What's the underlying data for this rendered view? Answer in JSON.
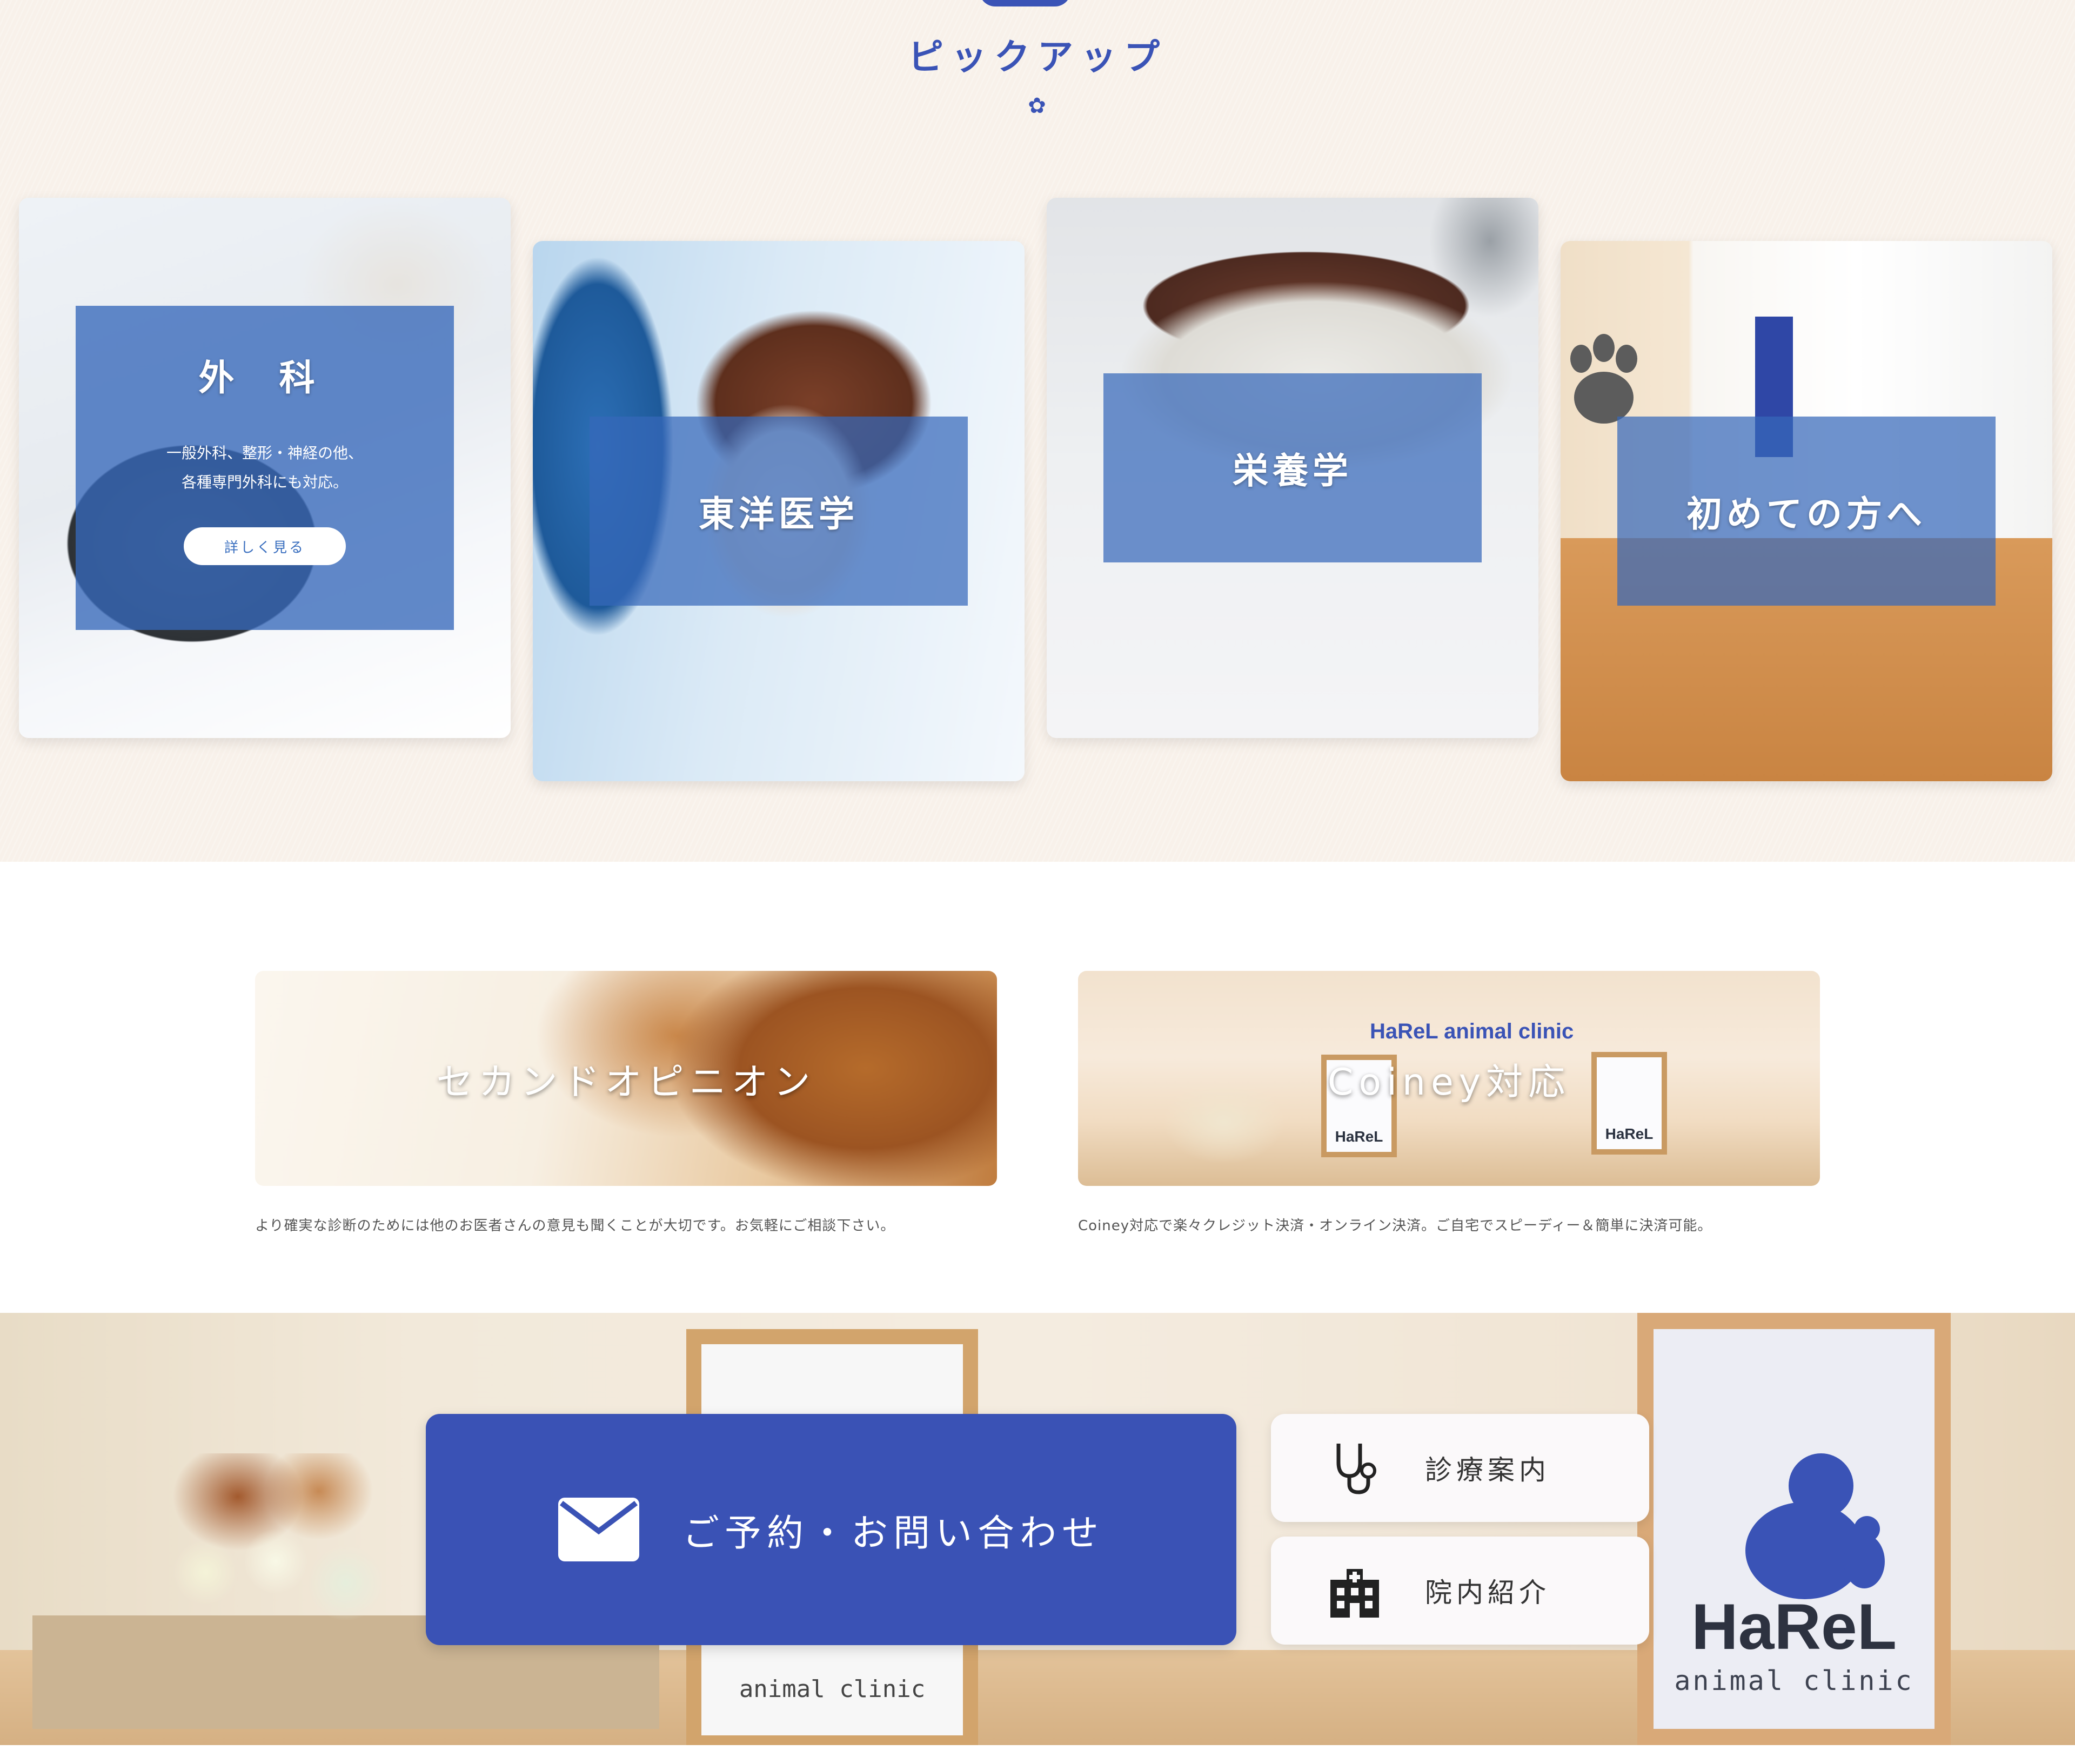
{
  "pickup": {
    "title": "ピックアップ",
    "cards": [
      {
        "label": "外 科",
        "desc_line1": "一般外科、整形・神経の他、",
        "desc_line2": "各種専門外科にも対応。",
        "more_label": "詳しく見る"
      },
      {
        "label": "東洋医学"
      },
      {
        "label": "栄養学"
      },
      {
        "label": "初めての方へ"
      }
    ]
  },
  "banners": [
    {
      "label": "セカンドオピニオン",
      "caption": "より確実な診断のためには他のお医者さんの意見も聞くことが大切です。お気軽にご相談下さい。"
    },
    {
      "label": "Coiney対応",
      "sign_text": "HaReL animal clinic",
      "frame_logo": "HaReL",
      "caption": "Coiney対応で楽々クレジット決済・オンライン決済。ご自宅でスピーディー＆簡単に決済可能。"
    }
  ],
  "footer_cta": {
    "contact_label": "ご予約・お問い合わせ",
    "side_buttons": [
      {
        "label": "診療案内",
        "icon": "stethoscope-icon"
      },
      {
        "label": "院内紹介",
        "icon": "hospital-icon"
      }
    ],
    "photo_logo": "HaReL",
    "photo_logo_sub": "animal clinic",
    "frame_sub": "animal clinic"
  },
  "colors": {
    "accent": "#3a53b6",
    "overlay": "#3668ba",
    "pickup_bg": "#f8f1ea"
  }
}
